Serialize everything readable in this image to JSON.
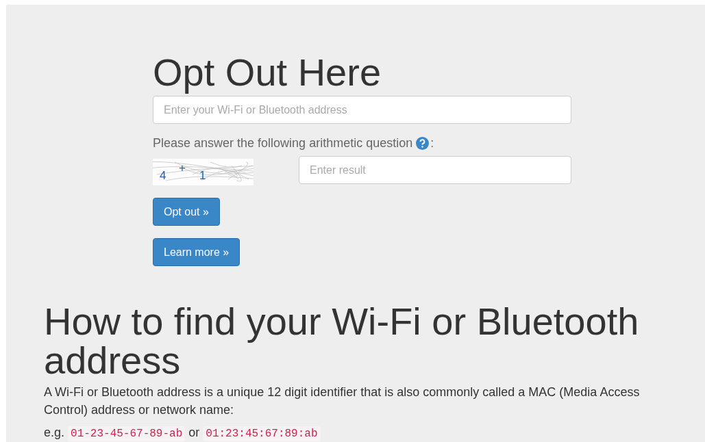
{
  "optout": {
    "title": "Opt Out Here",
    "address_field": {
      "placeholder": "Enter your Wi-Fi or Bluetooth address"
    },
    "question": {
      "label": "Please answer the following arithmetic question",
      "suffix": ":"
    },
    "captcha": [
      {
        "text": "4",
        "raised": false
      },
      {
        "text": "+",
        "raised": true
      },
      {
        "text": "1",
        "raised": false
      }
    ],
    "result_field": {
      "placeholder": "Enter result"
    },
    "buttons": [
      "Opt out »",
      "Learn more »"
    ]
  },
  "howto": {
    "title": "How to find your Wi-Fi or Bluetooth address",
    "text": "A Wi-Fi or Bluetooth address is a unique 12 digit identifier that is also commonly called a MAC (Media Access Control) address or network name:",
    "example": {
      "prefix": "e.g.",
      "codes": [
        "01-23-45-67-89-ab",
        "01:23:45:67:89:ab"
      ],
      "joiner": "or"
    }
  }
}
